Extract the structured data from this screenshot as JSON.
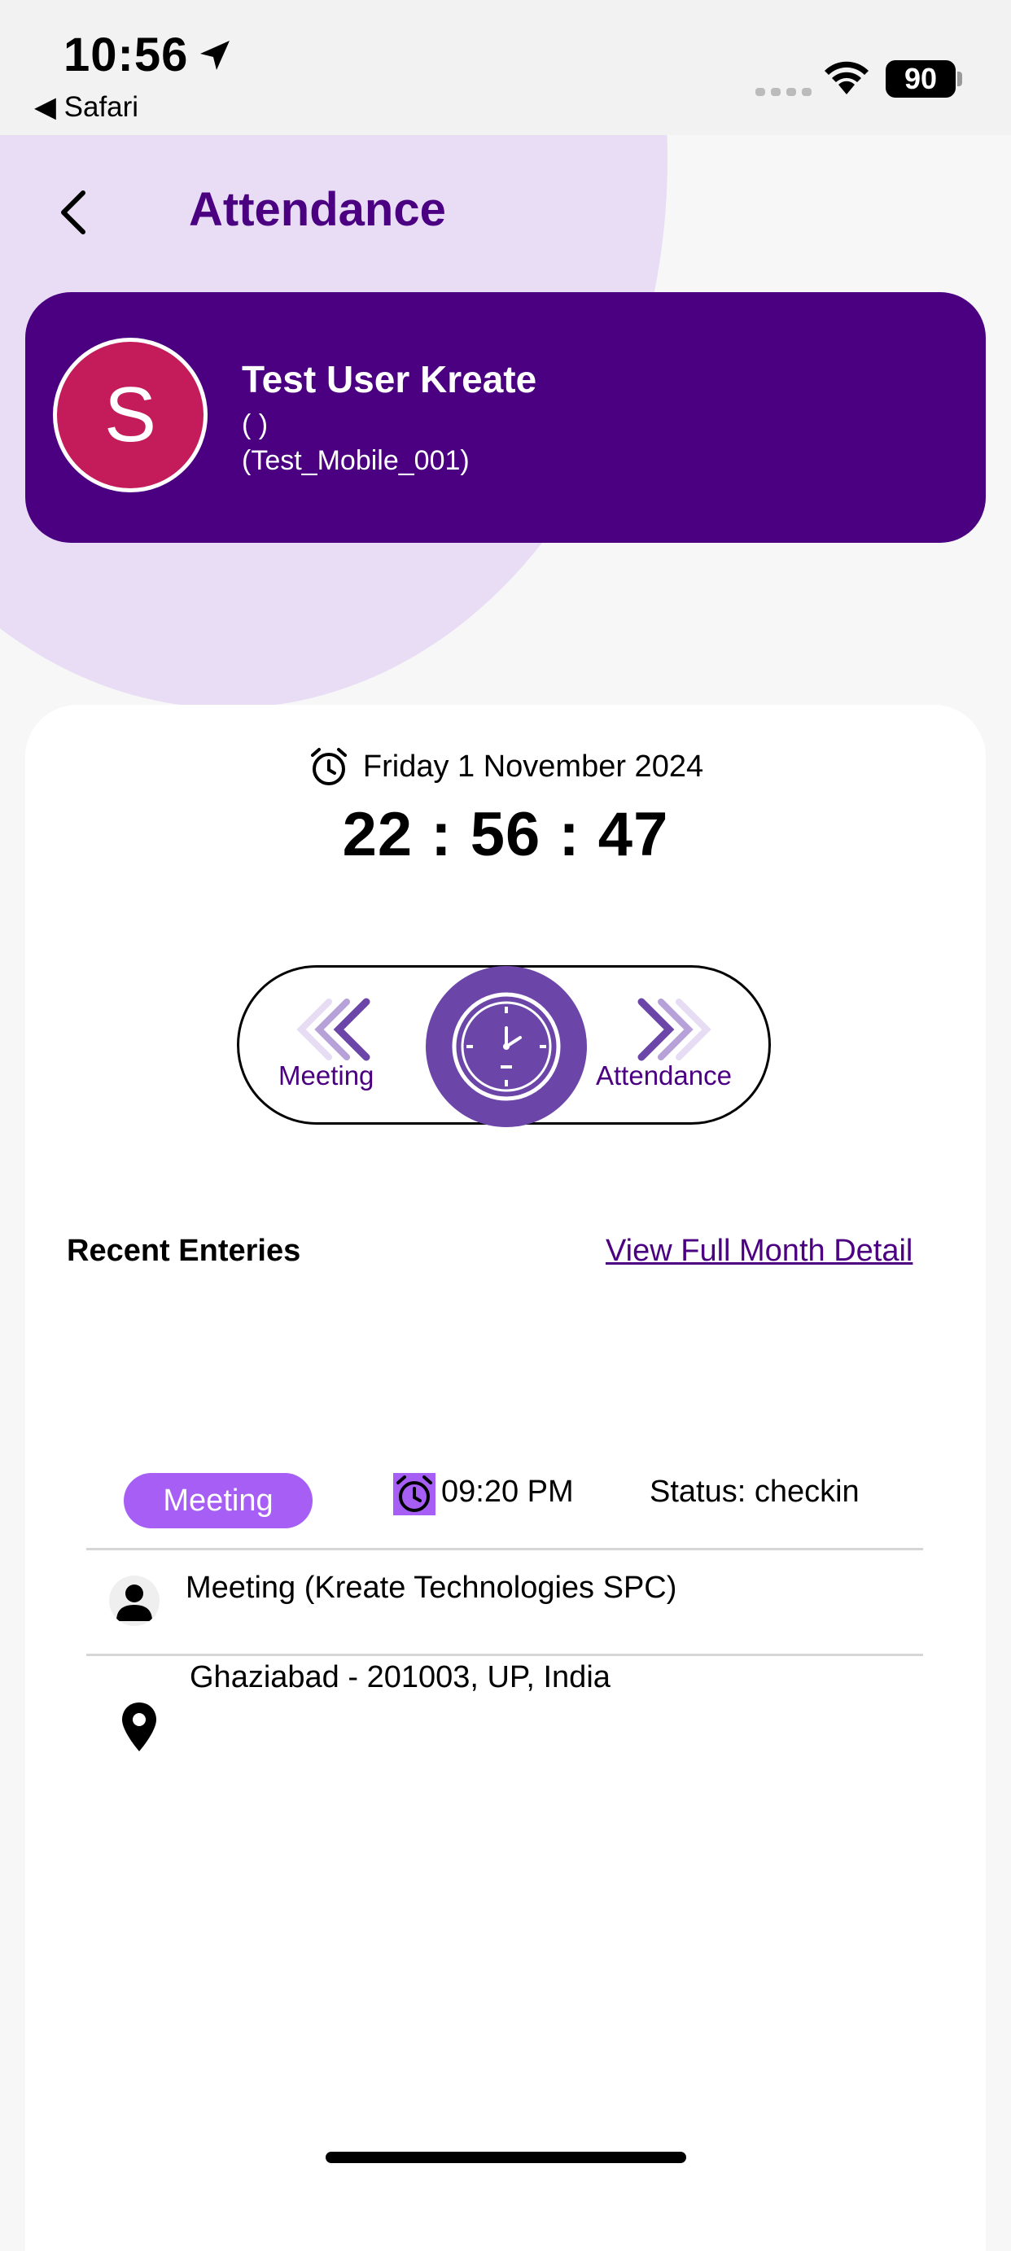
{
  "status_bar": {
    "time": "10:56",
    "back_app": "◀ Safari",
    "battery": "90",
    "icons": [
      "location-arrow-icon",
      "signal-icon",
      "wifi-icon",
      "battery-icon"
    ]
  },
  "header": {
    "title": "Attendance",
    "back_icon": "chevron-left-icon"
  },
  "profile": {
    "initial": "S",
    "name": "Test User Kreate",
    "subtitle": "(  )",
    "user_id": "(Test_Mobile_001)"
  },
  "clock": {
    "date": "Friday 1 November 2024",
    "time": "22 : 56 : 47"
  },
  "swipe": {
    "left_label": "Meeting",
    "right_label": "Attendance"
  },
  "recent": {
    "title": "Recent Enteries",
    "link": "View Full Month Detail"
  },
  "entry": {
    "type": "Meeting",
    "time": "09:20 PM",
    "status": "Status: checkin",
    "description": "Meeting (Kreate Technologies SPC)",
    "location": "Ghaziabad - 201003, UP, India"
  },
  "colors": {
    "brand": "#4b0082",
    "badge": "#a65ef5",
    "avatar": "#c41c5a",
    "knob": "#6b46a8"
  }
}
